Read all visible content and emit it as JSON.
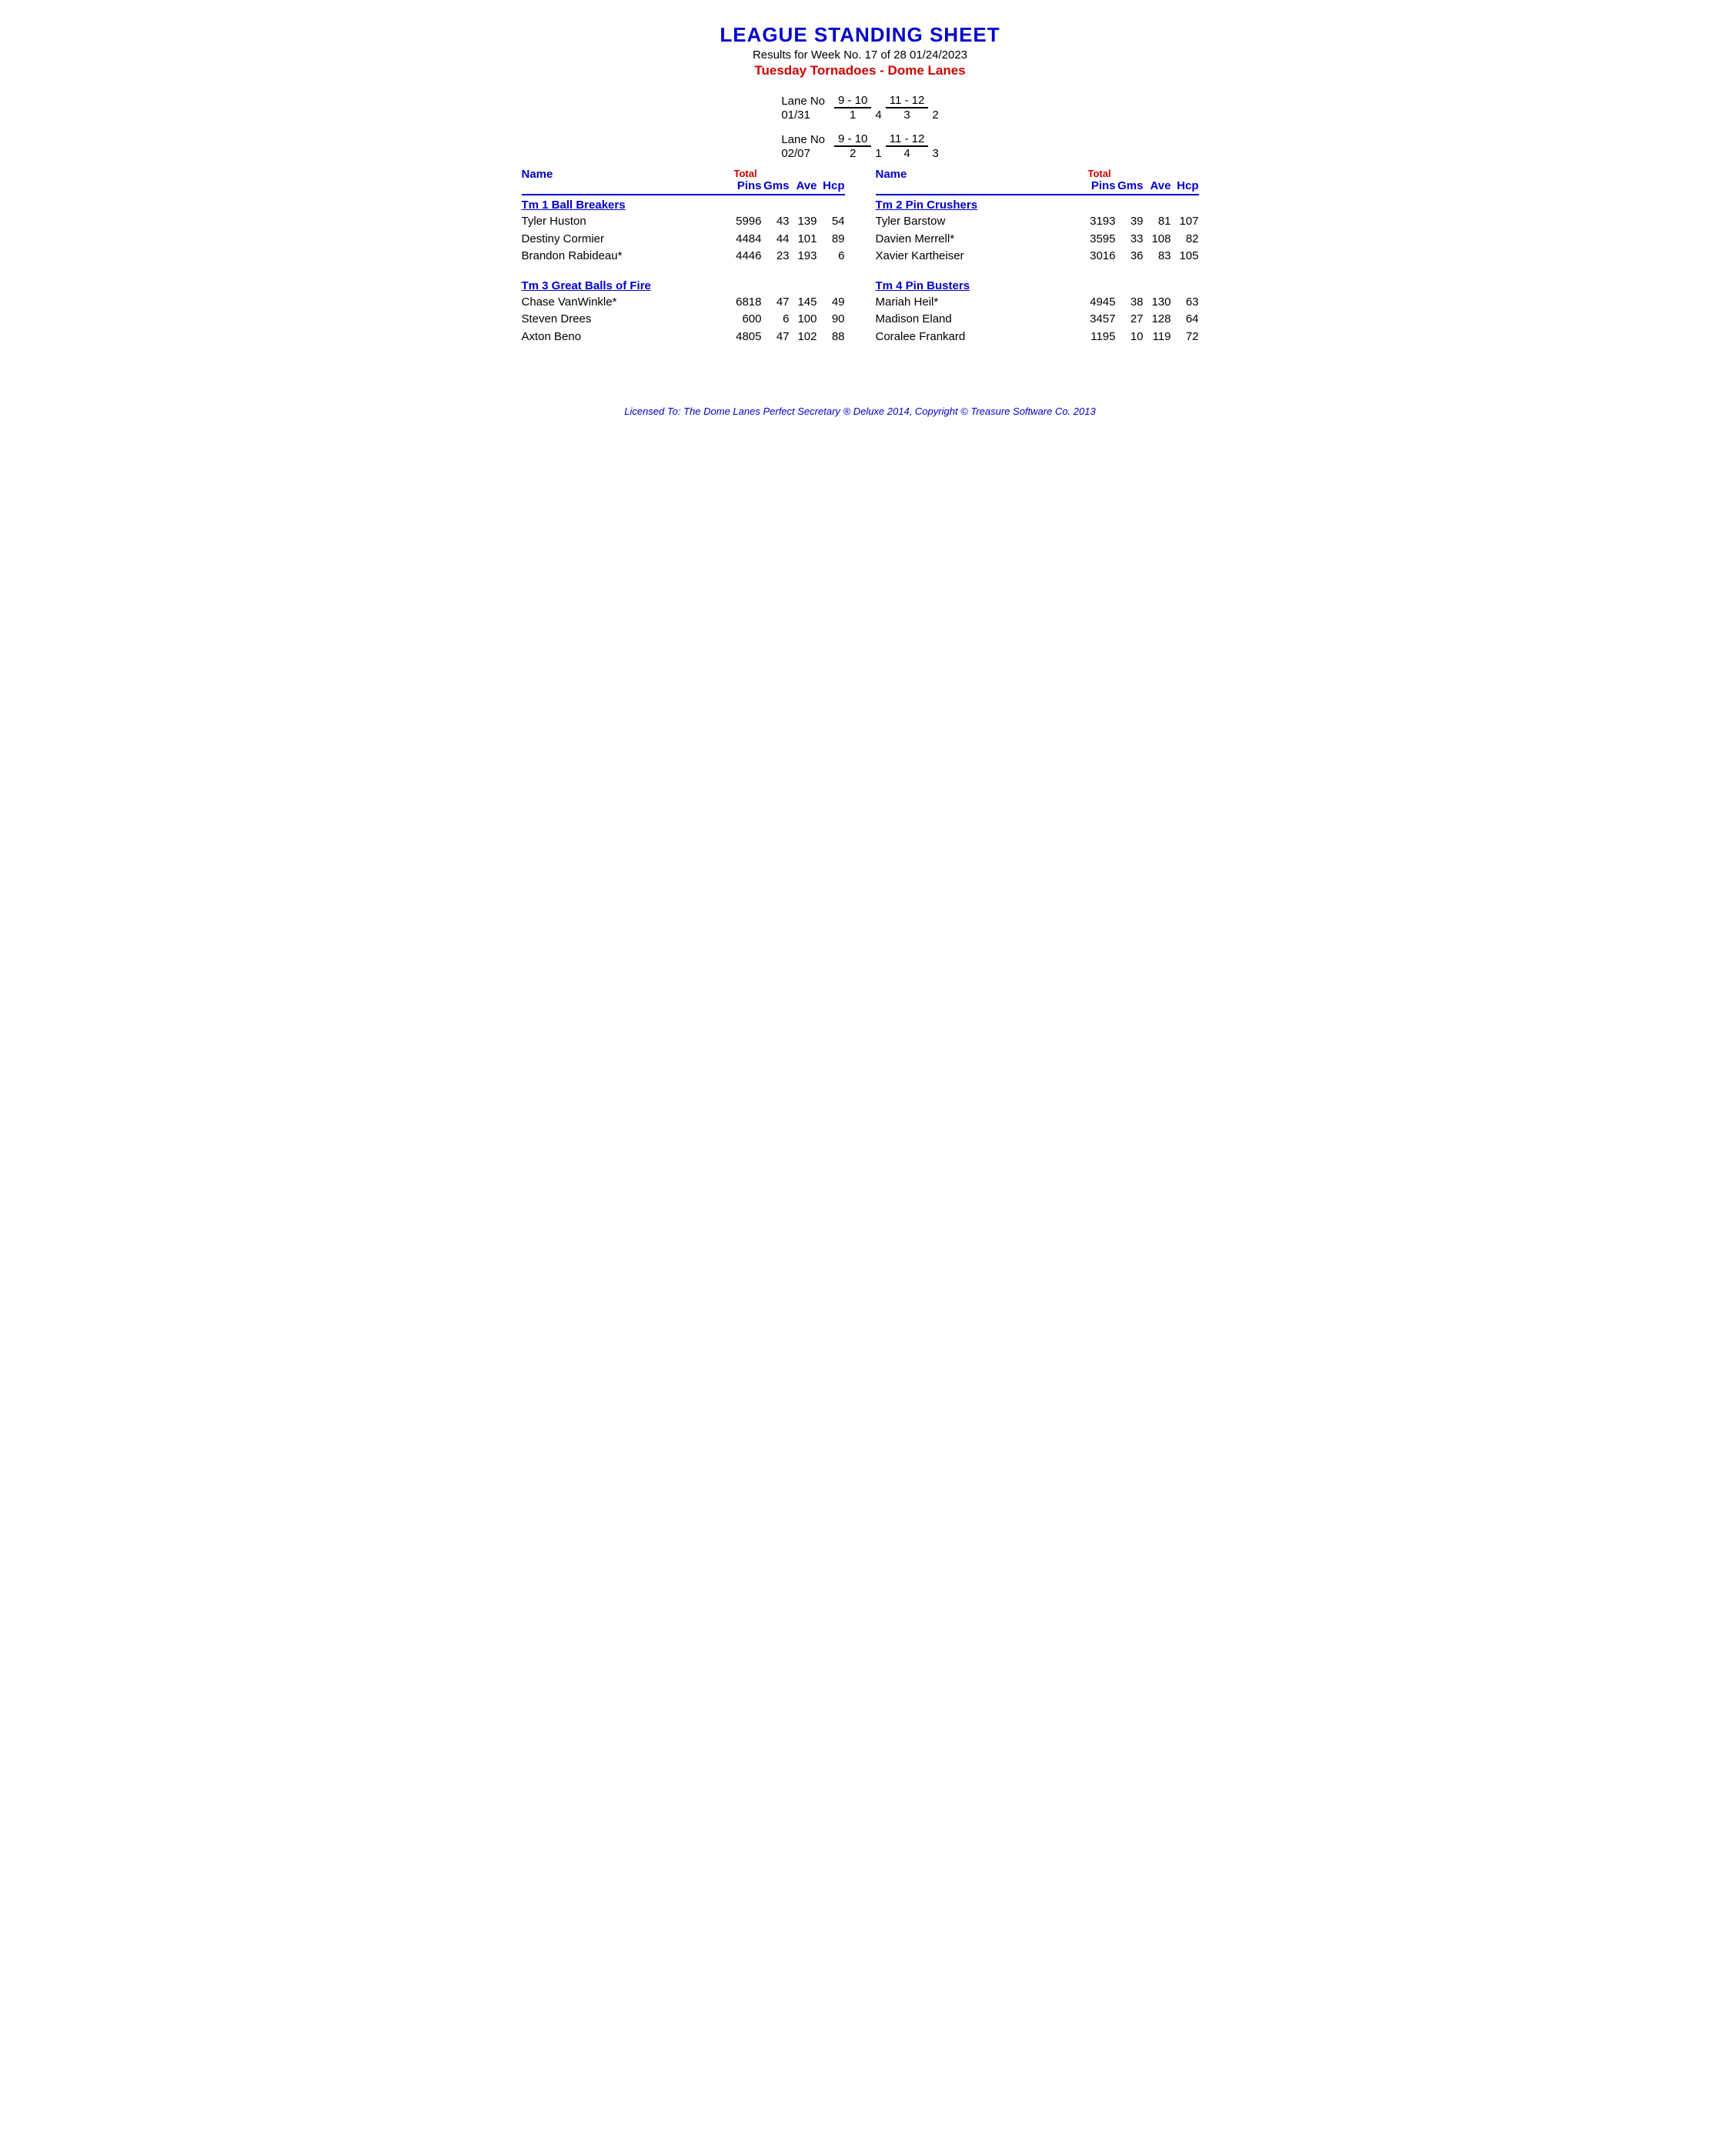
{
  "header": {
    "title": "LEAGUE STANDING SHEET",
    "subtitle": "Results for Week No. 17 of 28    01/24/2023",
    "league_name": "Tuesday Tornadoes - Dome Lanes"
  },
  "lanes": {
    "block1": {
      "label": "Lane No",
      "date": "01/31",
      "col1_header": "9 - 10",
      "col2_header": "11 - 12",
      "col1_vals": "1    4",
      "col2_vals": "3    2"
    },
    "block2": {
      "label": "Lane No",
      "date": "02/07",
      "col1_header": "9 - 10",
      "col2_header": "11 - 12",
      "col1_vals": "2    1",
      "col2_vals": "4    3"
    }
  },
  "columns": {
    "name": "Name",
    "total_label": "Total",
    "pins": "Pins",
    "gms": "Gms",
    "ave": "Ave",
    "hcp": "Hcp"
  },
  "left_teams": [
    {
      "name": "Tm 1 Ball Breakers",
      "players": [
        {
          "name": "Tyler Huston",
          "pins": "5996",
          "gms": "43",
          "ave": "139",
          "hcp": "54"
        },
        {
          "name": "Destiny Cormier",
          "pins": "4484",
          "gms": "44",
          "ave": "101",
          "hcp": "89"
        },
        {
          "name": "Brandon Rabideau*",
          "pins": "4446",
          "gms": "23",
          "ave": "193",
          "hcp": "6"
        }
      ]
    },
    {
      "name": "Tm 3 Great Balls of Fire",
      "players": [
        {
          "name": "Chase VanWinkle*",
          "pins": "6818",
          "gms": "47",
          "ave": "145",
          "hcp": "49"
        },
        {
          "name": "Steven Drees",
          "pins": "600",
          "gms": "6",
          "ave": "100",
          "hcp": "90"
        },
        {
          "name": "Axton Beno",
          "pins": "4805",
          "gms": "47",
          "ave": "102",
          "hcp": "88"
        }
      ]
    }
  ],
  "right_teams": [
    {
      "name": "Tm 2 Pin Crushers",
      "players": [
        {
          "name": "Tyler Barstow",
          "pins": "3193",
          "gms": "39",
          "ave": "81",
          "hcp": "107"
        },
        {
          "name": "Davien Merrell*",
          "pins": "3595",
          "gms": "33",
          "ave": "108",
          "hcp": "82"
        },
        {
          "name": "Xavier Kartheiser",
          "pins": "3016",
          "gms": "36",
          "ave": "83",
          "hcp": "105"
        }
      ]
    },
    {
      "name": "Tm 4 Pin Busters",
      "players": [
        {
          "name": "Mariah Heil*",
          "pins": "4945",
          "gms": "38",
          "ave": "130",
          "hcp": "63"
        },
        {
          "name": "Madison Eland",
          "pins": "3457",
          "gms": "27",
          "ave": "128",
          "hcp": "64"
        },
        {
          "name": "Coralee Frankard",
          "pins": "1195",
          "gms": "10",
          "ave": "119",
          "hcp": "72"
        }
      ]
    }
  ],
  "footer": {
    "text": "Licensed To: The Dome Lanes    Perfect Secretary ® Deluxe  2014, Copyright © Treasure Software Co. 2013"
  }
}
